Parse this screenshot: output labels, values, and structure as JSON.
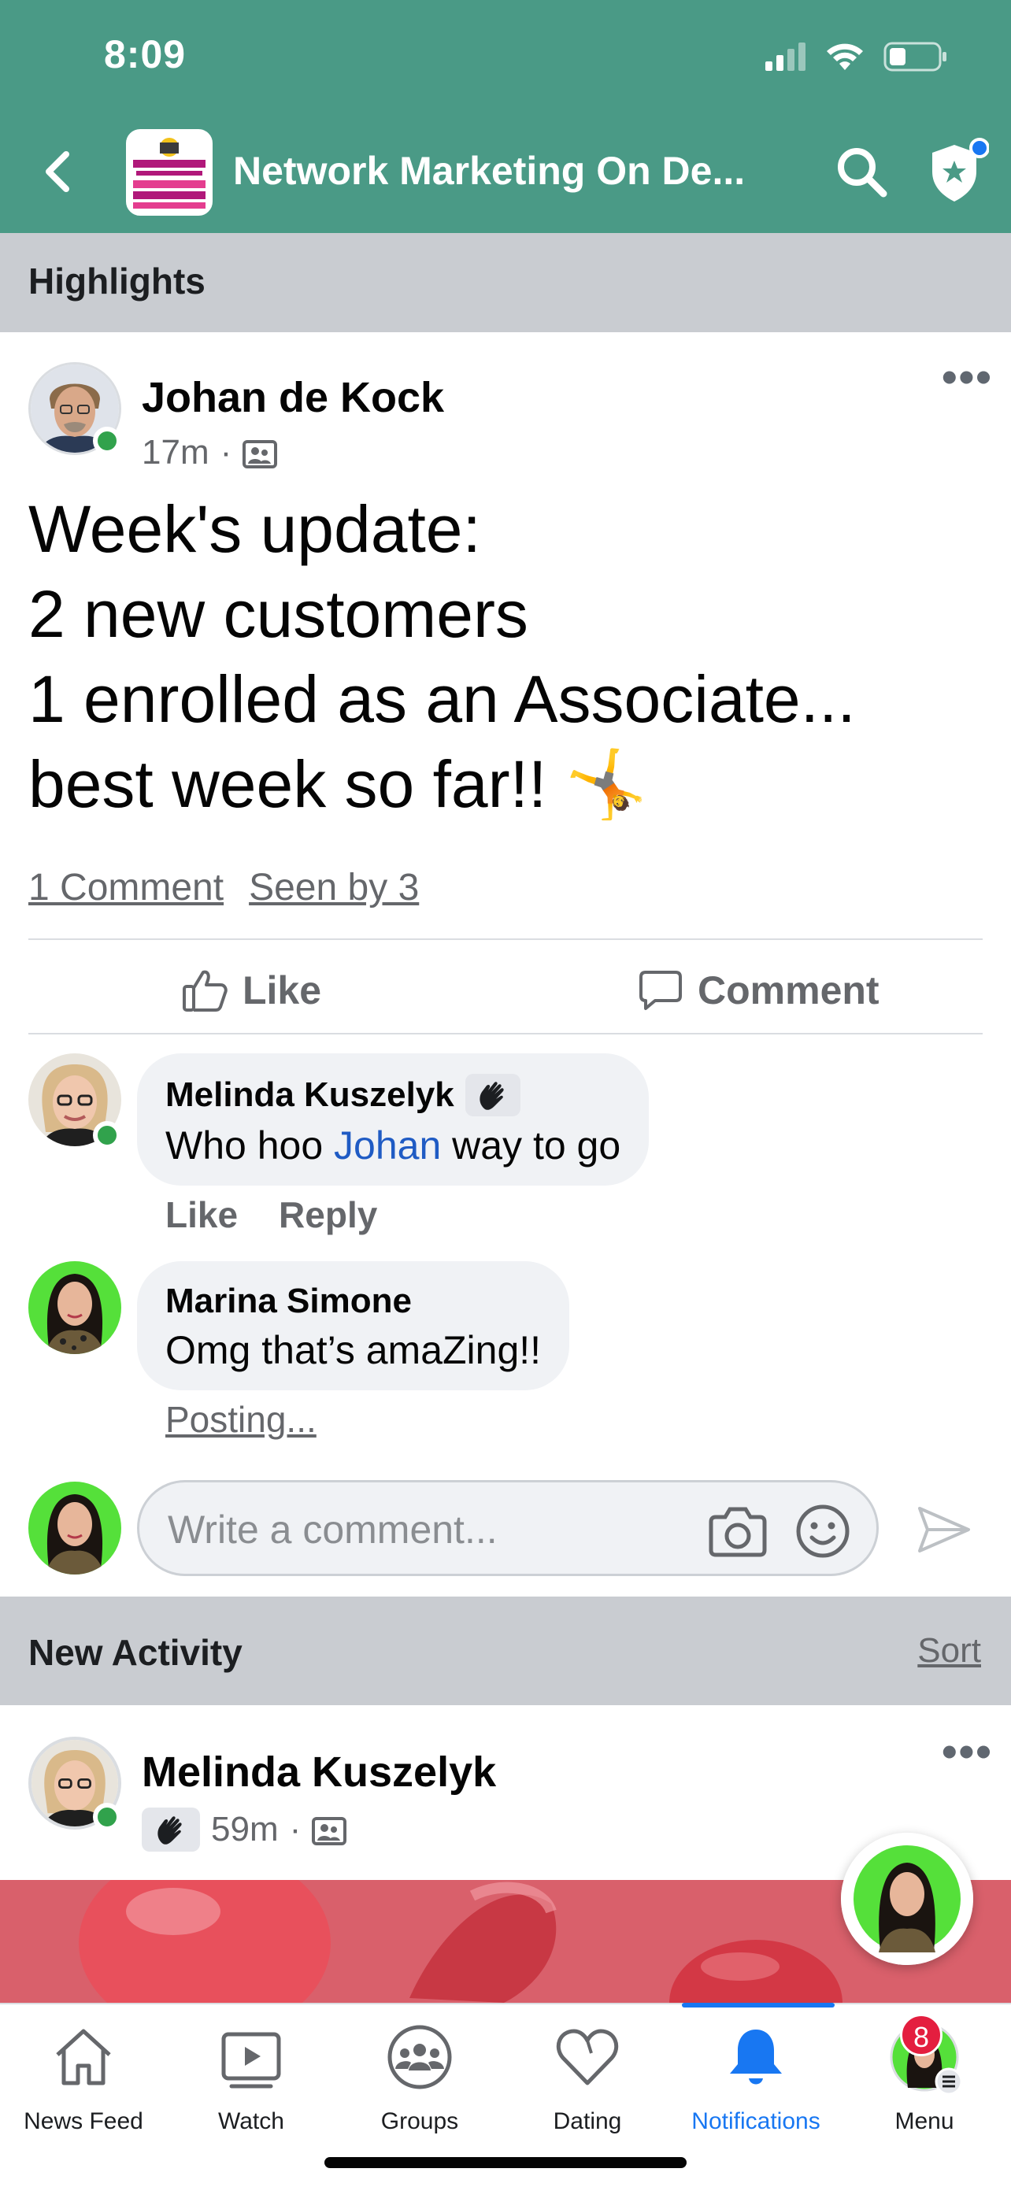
{
  "status_bar": {
    "time": "8:09"
  },
  "header": {
    "group_name": "Network Marketing On De...",
    "group_thumb_text": "NETWORK MARKETING ON DEMAND"
  },
  "highlights": {
    "label": "Highlights"
  },
  "post": {
    "author": "Johan de Kock",
    "time": "17m",
    "lines": [
      "Week's update:",
      "2 new customers",
      "1 enrolled as an Associate...",
      "best week so far!! 🤸"
    ],
    "comment_count": "1 Comment",
    "seen_by": "Seen by 3",
    "like_label": "Like",
    "comment_label": "Comment"
  },
  "comments": [
    {
      "name": "Melinda Kuszelyk",
      "text_before": "Who hoo ",
      "mention": "Johan",
      "text_after": " way to go",
      "like": "Like",
      "reply": "Reply"
    },
    {
      "name": "Marina Simone",
      "text": "Omg that’s amaZing!!",
      "status": "Posting..."
    }
  ],
  "composer": {
    "placeholder": "Write a comment..."
  },
  "new_activity": {
    "label": "New Activity",
    "sort": "Sort"
  },
  "post2": {
    "author": "Melinda Kuszelyk",
    "time": "59m"
  },
  "tabbar": {
    "tabs": [
      {
        "label": "News Feed",
        "icon": "home-icon"
      },
      {
        "label": "Watch",
        "icon": "play-icon"
      },
      {
        "label": "Groups",
        "icon": "groups-icon"
      },
      {
        "label": "Dating",
        "icon": "heart-icon"
      },
      {
        "label": "Notifications",
        "icon": "bell-icon",
        "active": true
      },
      {
        "label": "Menu",
        "icon": "avatar",
        "badge": "8"
      }
    ]
  },
  "colors": {
    "header": "#4a9a86",
    "accent": "#1877f2",
    "online": "#31a24c",
    "badge": "#e41e3f",
    "mention": "#1f5bc4"
  }
}
